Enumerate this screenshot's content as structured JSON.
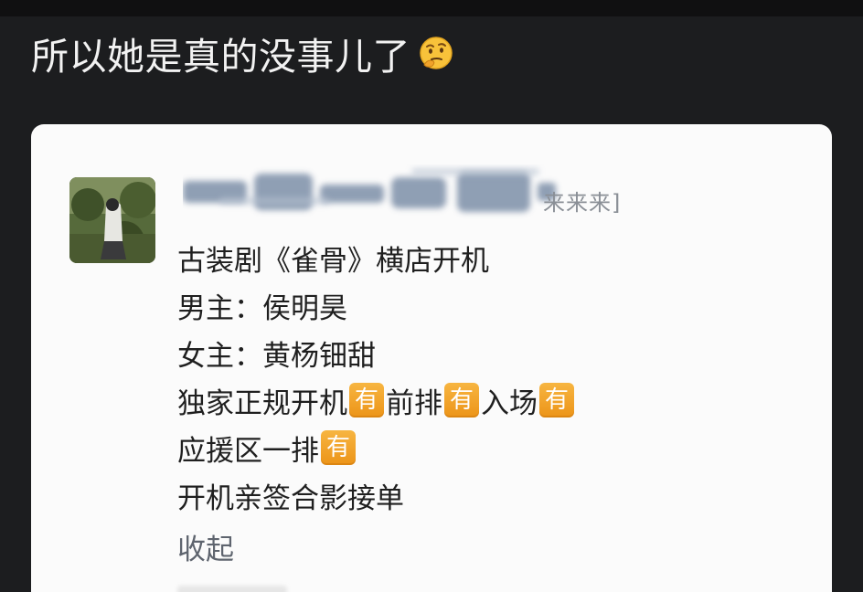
{
  "post": {
    "caption": "所以她是真的没事儿了",
    "caption_emoji": "thinking-face-icon"
  },
  "card": {
    "user_suffix": "来来来]",
    "lines": [
      {
        "parts": [
          "古装剧《雀骨》横店开机"
        ]
      },
      {
        "parts": [
          "男主：侯明昊"
        ]
      },
      {
        "parts": [
          "女主：黄杨钿甜"
        ]
      },
      {
        "parts": [
          "独家正规开机",
          "前排",
          "入场"
        ]
      },
      {
        "parts": [
          "应援区一排"
        ]
      },
      {
        "parts": [
          "开机亲签合影接单"
        ]
      }
    ],
    "badge_text": "有",
    "collapse_label": "收起"
  },
  "colors": {
    "page_background": "#1c1d1f",
    "card_background": "#fbfbfb",
    "badge": "#f0a12a",
    "link": "#5e646e"
  }
}
